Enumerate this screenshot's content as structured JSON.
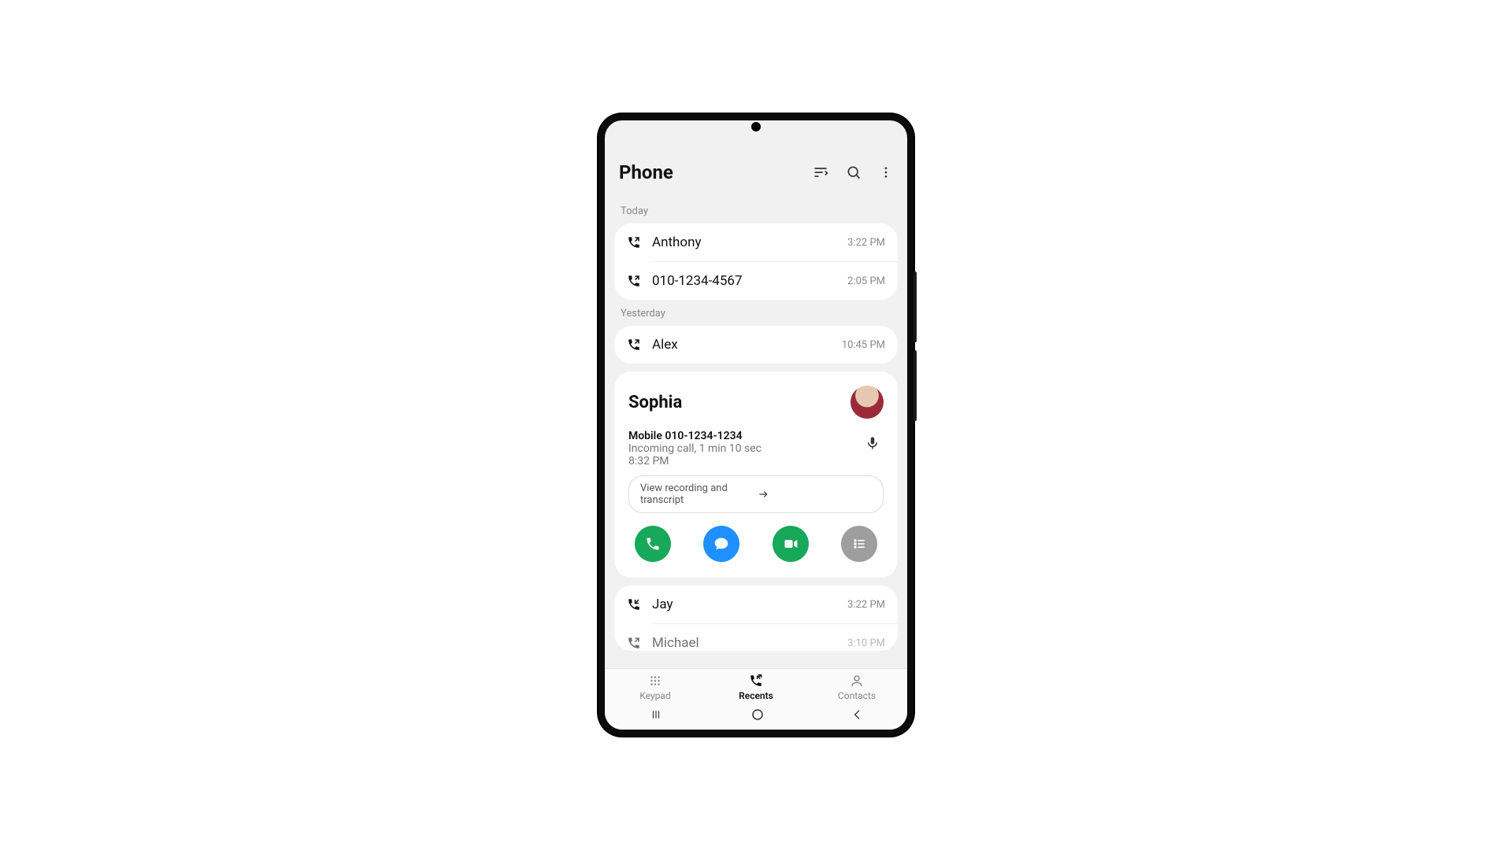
{
  "header": {
    "title": "Phone"
  },
  "sections": {
    "today_label": "Today",
    "yesterday_label": "Yesterday"
  },
  "today": [
    {
      "name": "Anthony",
      "time": "3:22 PM",
      "type": "outgoing"
    },
    {
      "name": "010-1234-4567",
      "time": "2:05 PM",
      "type": "outgoing"
    }
  ],
  "yesterday": [
    {
      "name": "Alex",
      "time": "10:45 PM",
      "type": "outgoing"
    }
  ],
  "expanded": {
    "name": "Sophia",
    "line1": "Mobile 010-1234-1234",
    "line2": "Incoming call, 1 min 10 sec",
    "time": "8:32 PM",
    "pill": "View recording and transcript"
  },
  "more": [
    {
      "name": "Jay",
      "time": "3:22 PM",
      "type": "incoming"
    },
    {
      "name": "Michael",
      "time": "3:10 PM",
      "type": "outgoing"
    }
  ],
  "bottom": {
    "keypad": "Keypad",
    "recents": "Recents",
    "contacts": "Contacts"
  }
}
